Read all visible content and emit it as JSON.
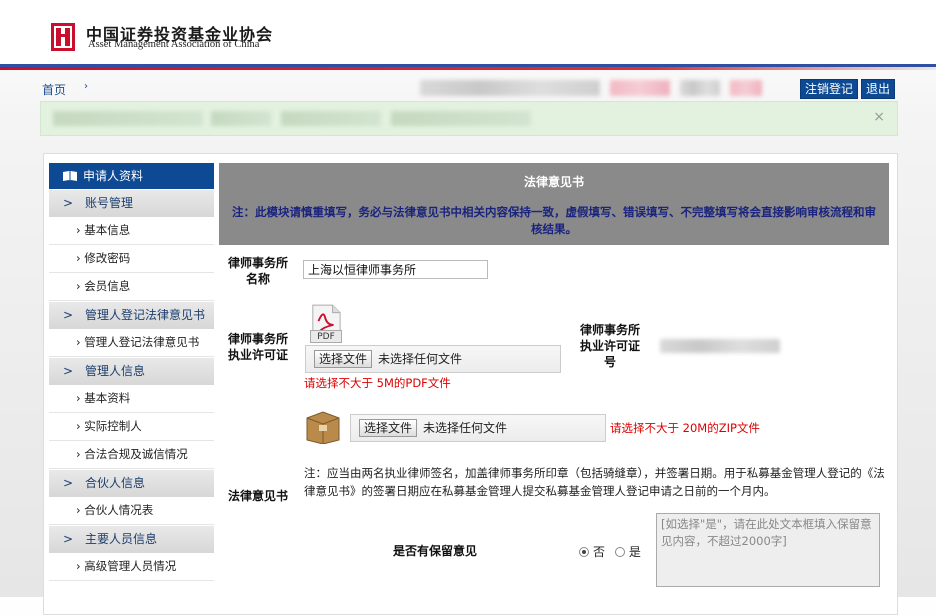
{
  "header": {
    "org_name_cn": "中国证券投资基金业协会",
    "org_name_en": "Asset Management Association of China"
  },
  "nav": {
    "home": "首页",
    "logout_button": "注销登记",
    "exit_button": "退出"
  },
  "notice": {
    "close": "×"
  },
  "sidebar": {
    "header": "申请人资料",
    "groups": [
      {
        "label": "账号管理",
        "items": [
          "基本信息",
          "修改密码",
          "会员信息"
        ]
      },
      {
        "label": "管理人登记法律意见书",
        "items": [
          "管理人登记法律意见书"
        ]
      },
      {
        "label": "管理人信息",
        "items": [
          "基本资料",
          "实际控制人",
          "合法合规及诚信情况"
        ]
      },
      {
        "label": "合伙人信息",
        "items": [
          "合伙人情况表"
        ]
      },
      {
        "label": "主要人员信息",
        "items": [
          "高级管理人员情况"
        ]
      }
    ]
  },
  "content": {
    "title": "法律意见书",
    "warning": "注：此模块请慎重填写，务必与法律意见书中相关内容保持一致，虚假填写、错误填写、不完整填写将会直接影响审核流程和审核结果。",
    "firm_name_label": "律师事务所名称",
    "firm_name_value": "上海以恒律师事务所",
    "license_label": "律师事务所执业许可证",
    "license_icon_text": "PDF",
    "license_no_label": "律师事务所执业许可证号",
    "file_button": "选择文件",
    "no_file": "未选择任何文件",
    "pdf_hint": "请选择不大于 5M的PDF文件",
    "zip_hint": "请选择不大于 20M的ZIP文件",
    "opinion_label": "法律意见书",
    "opinion_note": "注：应当由两名执业律师签名，加盖律师事务所印章（包括骑缝章），并签署日期。用于私募基金管理人登记的《法律意见书》的签署日期应在私募基金管理人提交私募基金管理人登记申请之日前的一个月内。",
    "reserve_label": "是否有保留意见",
    "radio_no": "否",
    "radio_yes": "是",
    "reserve_placeholder": "[如选择\"是\"，请在此处文本框填入保留意见内容，不超过2000字]"
  }
}
